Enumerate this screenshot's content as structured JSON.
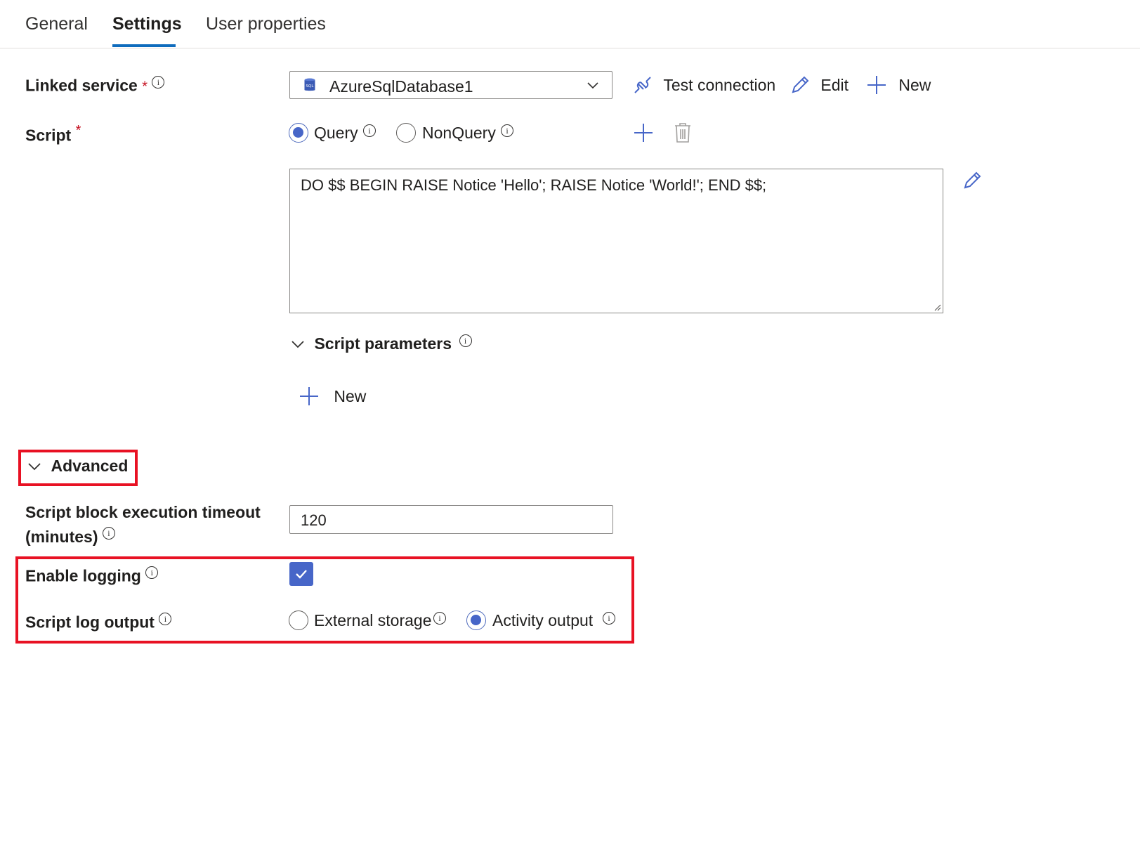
{
  "tabs": [
    {
      "label": "General"
    },
    {
      "label": "Settings"
    },
    {
      "label": "User properties"
    }
  ],
  "linked_service": {
    "label": "Linked service",
    "required_mark": "*",
    "value": "AzureSqlDatabase1",
    "db_badge": "SQL",
    "actions": {
      "test_connection": "Test connection",
      "edit": "Edit",
      "new": "New"
    }
  },
  "script": {
    "label": "Script",
    "required_mark": "*",
    "options": [
      {
        "label": "Query",
        "selected": true
      },
      {
        "label": "NonQuery",
        "selected": false
      }
    ],
    "text": "DO $$ BEGIN RAISE Notice 'Hello'; RAISE Notice 'World!'; END $$;",
    "parameters_label": "Script parameters",
    "parameters_new": "New"
  },
  "advanced": {
    "label": "Advanced",
    "timeout_label_line1": "Script block execution timeout",
    "timeout_label_line2": "(minutes)",
    "timeout_value": "120",
    "enable_logging_label": "Enable logging",
    "enable_logging_checked": true,
    "log_output_label": "Script log output",
    "log_output_options": [
      {
        "label": "External storage",
        "selected": false
      },
      {
        "label": "Activity output",
        "selected": true
      }
    ]
  },
  "colors": {
    "accent": "#4766c8",
    "highlight_box": "#e81123",
    "required": "#c50f1f"
  },
  "icons": {
    "info": "i"
  }
}
